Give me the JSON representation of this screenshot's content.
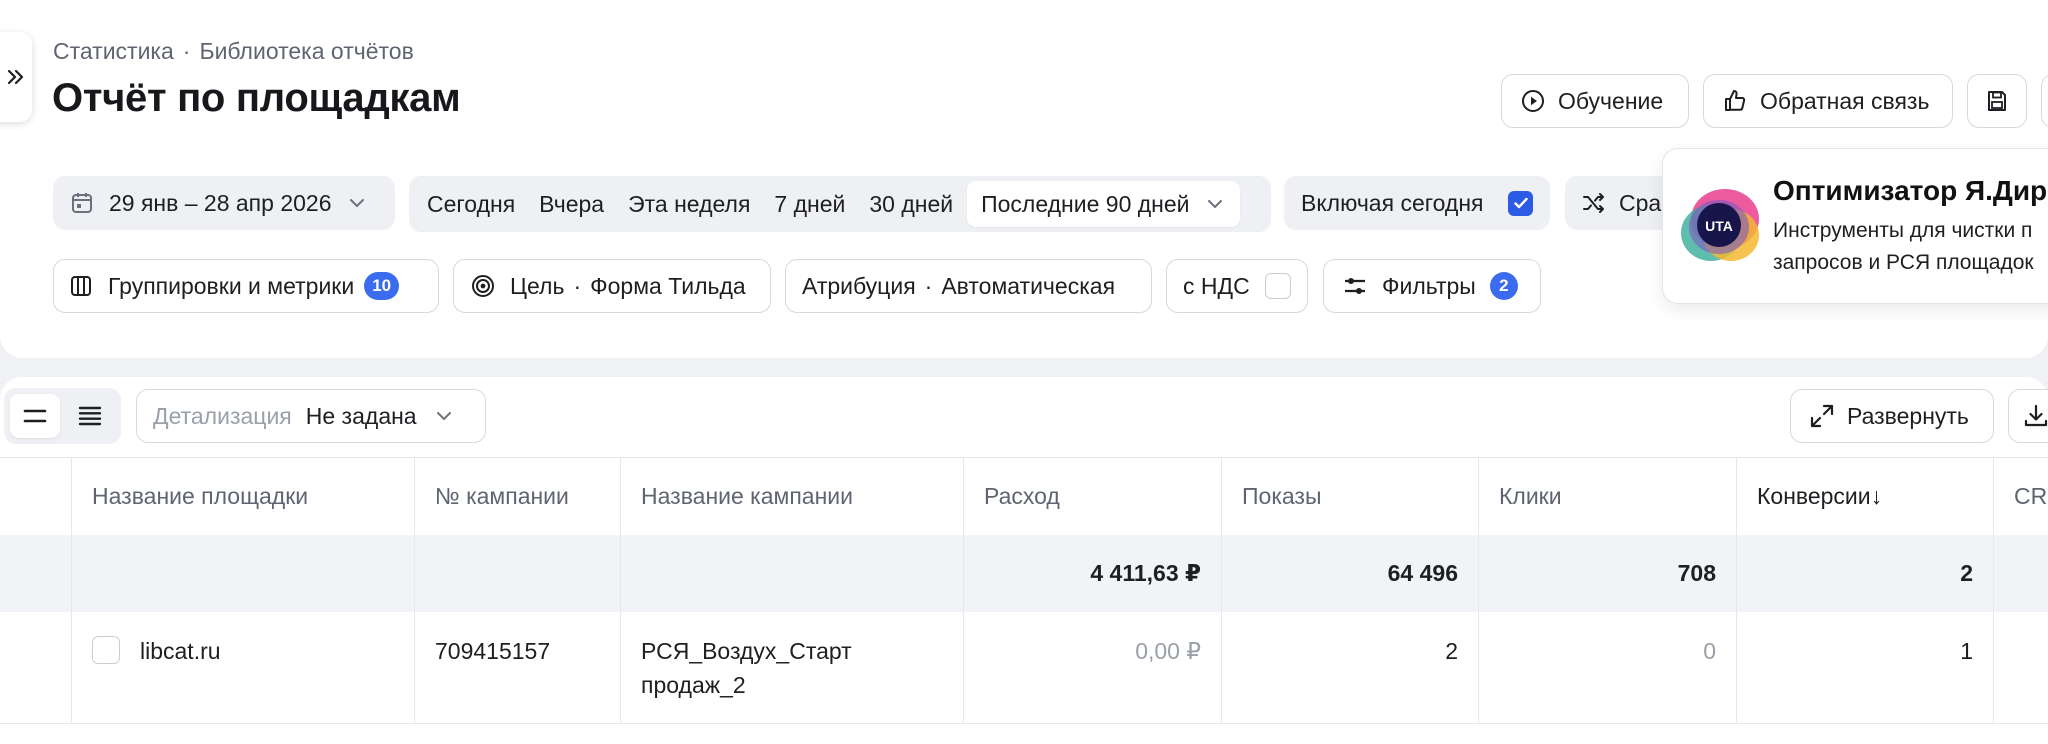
{
  "breadcrumb": {
    "root": "Статистика",
    "separator": "·",
    "current": "Библиотека отчётов"
  },
  "page": {
    "title": "Отчёт по площадкам"
  },
  "header_buttons": {
    "tutorial": "Обучение",
    "feedback": "Обратная связь"
  },
  "filters": {
    "date_range": "29 янв – 28 апр 2026",
    "presets": [
      "Сегодня",
      "Вчера",
      "Эта неделя",
      "7 дней",
      "30 дней"
    ],
    "selected_preset": "Последние 90 дней",
    "include_today": "Включая сегодня",
    "compare": "Сра",
    "groupings": "Группировки и метрики",
    "groupings_count": "10",
    "goal_label": "Цель",
    "goal_value": "Форма Тильда",
    "attribution_label": "Атрибуция",
    "attribution_value": "Автоматическая",
    "vat": "с НДС",
    "filters": "Фильтры",
    "filters_count": "2"
  },
  "promo": {
    "logo_text": "UTA",
    "title": "Оптимизатор Я.Дир",
    "line1": "Инструменты для чистки п",
    "line2": "запросов и РСЯ площадок"
  },
  "toolbar": {
    "detail_label": "Детализация",
    "detail_value": "Не задана",
    "expand": "Развернуть"
  },
  "table": {
    "columns": [
      "Название площадки",
      "№ кампании",
      "Название кампании",
      "Расход",
      "Показы",
      "Клики",
      "Конверсии↓",
      "CR"
    ],
    "totals": {
      "spend": "4 411,63 ₽",
      "impressions": "64 496",
      "clicks": "708",
      "conversions": "2"
    },
    "rows": [
      {
        "site": "libcat.ru",
        "campaign_id": "709415157",
        "campaign_name_l1": "РСЯ_Воздух_Старт",
        "campaign_name_l2": "продаж_2",
        "spend": "0,00 ₽",
        "impressions": "2",
        "clicks": "0",
        "conversions": "1"
      }
    ]
  },
  "colors": {
    "accent": "#2c5ce6",
    "badge": "#3b6cf0",
    "page_bg": "#eff1f4",
    "muted": "#9aa0a9"
  }
}
